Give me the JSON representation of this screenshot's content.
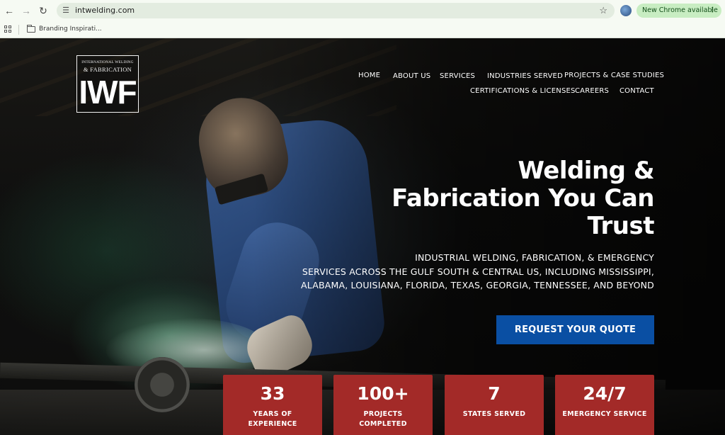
{
  "browser": {
    "url": "intwelding.com",
    "update_label": "New Chrome available",
    "bookmark_label": "Branding Inspirati..."
  },
  "logo": {
    "line1": "INTERNATIONAL WELDING",
    "line2": "& FABRICATION",
    "monogram": "IWF"
  },
  "nav": {
    "row1": [
      "HOME",
      "ABOUT US",
      "SERVICES",
      "INDUSTRIES SERVED",
      "PROJECTS & CASE STUDIES"
    ],
    "row2": [
      "CERTIFICATIONS & LICENSES",
      "CAREERS",
      "CONTACT"
    ]
  },
  "hero": {
    "title_line1": "Welding &",
    "title_line2": "Fabrication You Can",
    "title_line3": "Trust",
    "sub_line1": "INDUSTRIAL WELDING, FABRICATION, & EMERGENCY",
    "sub_line2": "SERVICES ACROSS THE GULF SOUTH & CENTRAL US, INCLUDING MISSISSIPPI,",
    "sub_line3": "ALABAMA, LOUISIANA, FLORIDA, TEXAS, GEORGIA, TENNESSEE, AND BEYOND",
    "cta_label": "REQUEST YOUR QUOTE"
  },
  "stats": [
    {
      "number": "33",
      "label_line1": "YEARS OF",
      "label_line2": "EXPERIENCE"
    },
    {
      "number": "100+",
      "label_line1": "PROJECTS",
      "label_line2": "COMPLETED"
    },
    {
      "number": "7",
      "label_line1": "STATES SERVED",
      "label_line2": ""
    },
    {
      "number": "24/7",
      "label_line1": "EMERGENCY SERVICE",
      "label_line2": ""
    }
  ],
  "colors": {
    "cta_blue": "#0a4fa3",
    "stat_red": "#a32a28",
    "chrome_update_green": "#c8edc2"
  }
}
